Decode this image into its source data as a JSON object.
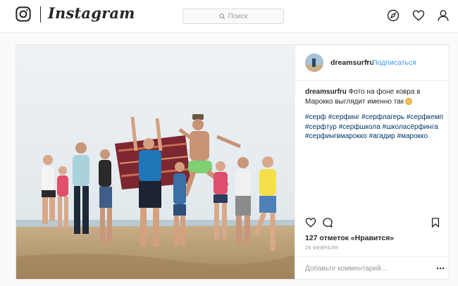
{
  "header": {
    "logo_text": "Instagram",
    "search_placeholder": "Поиск",
    "icons": [
      "instagram-glyph-icon",
      "search-icon",
      "compass-icon",
      "heart-icon",
      "user-icon"
    ]
  },
  "post": {
    "username": "dreamsurfru",
    "separator": "•",
    "follow_label": "Подписаться",
    "caption_user": "dreamsurfru",
    "caption_text": " Фото на фоне ковра в Марокко выглядит именно так",
    "hashtags": "#серф #серфинг #серфлагерь #серфкемп #серфтур #серфшкола #школасёрфинга #серфингвмарокко #агадир #марокко",
    "likes": "127 отметок «Нравится»",
    "date": "26 ФЕВРАЛЯ",
    "comment_placeholder": "Добавьте комментарий...",
    "action_icons": [
      "heart-outline-icon",
      "comment-icon",
      "bookmark-icon",
      "more-icon"
    ]
  },
  "colors": {
    "link_blue": "#3897f0",
    "hashtag_blue": "#003569",
    "border": "#e6e6e6",
    "background": "#fafafa"
  }
}
